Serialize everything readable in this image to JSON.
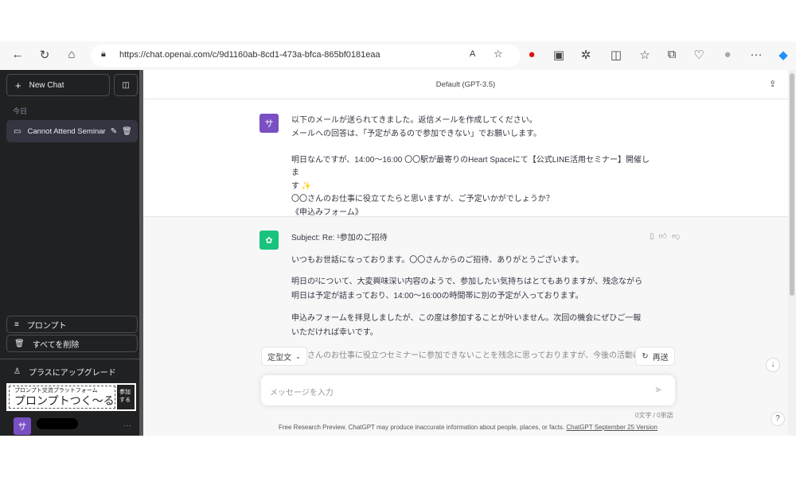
{
  "browser": {
    "url": "https://chat.openai.com/c/9d1160ab-8cd1-473a-bfca-865bf0181eaa"
  },
  "sidebar": {
    "new_chat": "New Chat",
    "section_today": "今日",
    "chat_item": "Cannot Attend Seminar",
    "prompt": "プロンプト",
    "delete_all": "すべてを削除",
    "upgrade": "プラスにアップグレード",
    "banner_small": "プロンプト交流プラットフォーム",
    "banner_big": "プロンプトつく〜る",
    "banner_join": "参加する",
    "user_initial": "サ",
    "more": "···"
  },
  "header": {
    "model": "Default (GPT-3.5)"
  },
  "user_message": {
    "avatar": "サ",
    "lines": [
      "以下のメールが送られてきました。返信メールを作成してください。",
      "メールへの回答は、「予定があるので参加できない」でお願いします。",
      "",
      "明日なんですが、14:00〜16:00 〇〇駅が最寄りのHeart Spaceにて【公式LINE活用セミナー】開催しま",
      "す ✨",
      "〇〇さんのお仕事に役立てたらと思いますが、ご予定いかがでしょうか？",
      "《申込みフォーム》"
    ]
  },
  "assistant_message": {
    "subject": "Subject: Re: ¹参加のご招待",
    "paragraphs": [
      "いつもお世話になっております。〇〇さんからのご招待、ありがとうございます。",
      "明日の²について、大変興味深い内容のようで、参加したい気持ちはとてもありますが、残念ながら明日は予定が詰まっており、14:00〜16:00の時間帯に別の予定が入っております。",
      "申込みフォームを拝見しましたが、この度は参加することが叶いません。次回の機会にぜひご一報いただければ幸いです。",
      "〇〇さんのお仕事に役立つセミナーに参加できないことを残念に思っておりますが、今後の活動にご成功を"
    ]
  },
  "composer": {
    "template_label": "定型文",
    "resend_label": "再送",
    "placeholder": "メッセージを入力",
    "counter": "0文字 / 0単語"
  },
  "footer": {
    "text": "Free Research Preview. ChatGPT may produce inaccurate information about people, places, or facts. ",
    "link": "ChatGPT September 25 Version"
  },
  "help": "?",
  "colors": {
    "sidebar": "#202123",
    "user_avatar": "#7a4fc4",
    "gpt_avatar": "#19c37d"
  }
}
